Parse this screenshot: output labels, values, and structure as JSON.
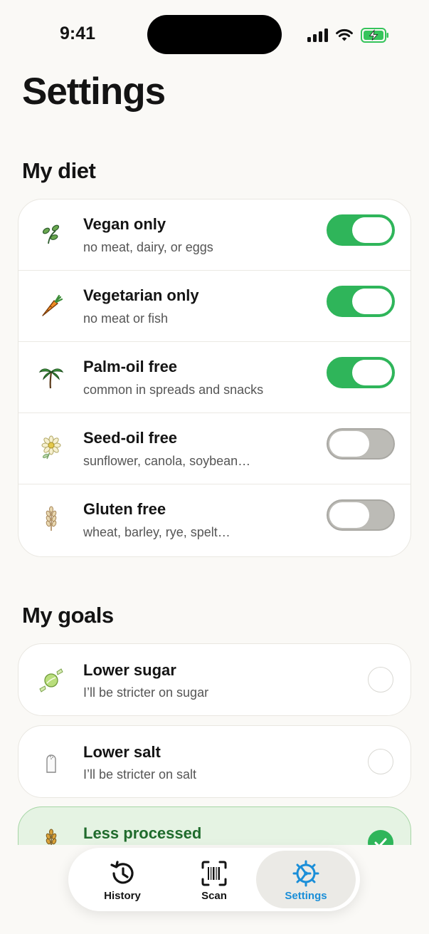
{
  "status_bar": {
    "time": "9:41",
    "icons": [
      "cellular-signal-icon",
      "wifi-icon",
      "battery-charging-icon"
    ],
    "battery_color": "#36c45b"
  },
  "page_title": "Settings",
  "diet": {
    "section_title": "My diet",
    "items": [
      {
        "title": "Vegan only",
        "subtitle": "no meat, dairy, or eggs",
        "icon": "sprout-icon",
        "enabled": true
      },
      {
        "title": "Vegetarian only",
        "subtitle": "no meat or fish",
        "icon": "carrot-icon",
        "enabled": true
      },
      {
        "title": "Palm-oil free",
        "subtitle": "common in spreads and snacks",
        "icon": "palm-tree-icon",
        "enabled": true
      },
      {
        "title": "Seed-oil free",
        "subtitle": "sunflower, canola, soybean…",
        "icon": "flower-icon",
        "enabled": false
      },
      {
        "title": "Gluten free",
        "subtitle": "wheat, barley, rye, spelt…",
        "icon": "wheat-icon",
        "enabled": false
      }
    ]
  },
  "goals": {
    "section_title": "My goals",
    "items": [
      {
        "title": "Lower sugar",
        "subtitle": "I’ll be stricter on sugar",
        "icon": "candy-icon",
        "selected": false
      },
      {
        "title": "Lower salt",
        "subtitle": "I’ll be stricter on salt",
        "icon": "salt-shaker-icon",
        "selected": false
      },
      {
        "title": "Less processed",
        "subtitle": "",
        "icon": "wheat-icon",
        "selected": true
      }
    ]
  },
  "tab_bar": {
    "tabs": [
      {
        "label": "History",
        "icon": "history-icon",
        "active": false
      },
      {
        "label": "Scan",
        "icon": "barcode-scan-icon",
        "active": false
      },
      {
        "label": "Settings",
        "icon": "settings-gear-icon",
        "active": true
      }
    ]
  },
  "colors": {
    "toggle_on": "#2fb55a",
    "toggle_off": "#bcbbb6",
    "accent_blue": "#1a8ed8",
    "selected_card_bg": "#e5f3e3"
  }
}
